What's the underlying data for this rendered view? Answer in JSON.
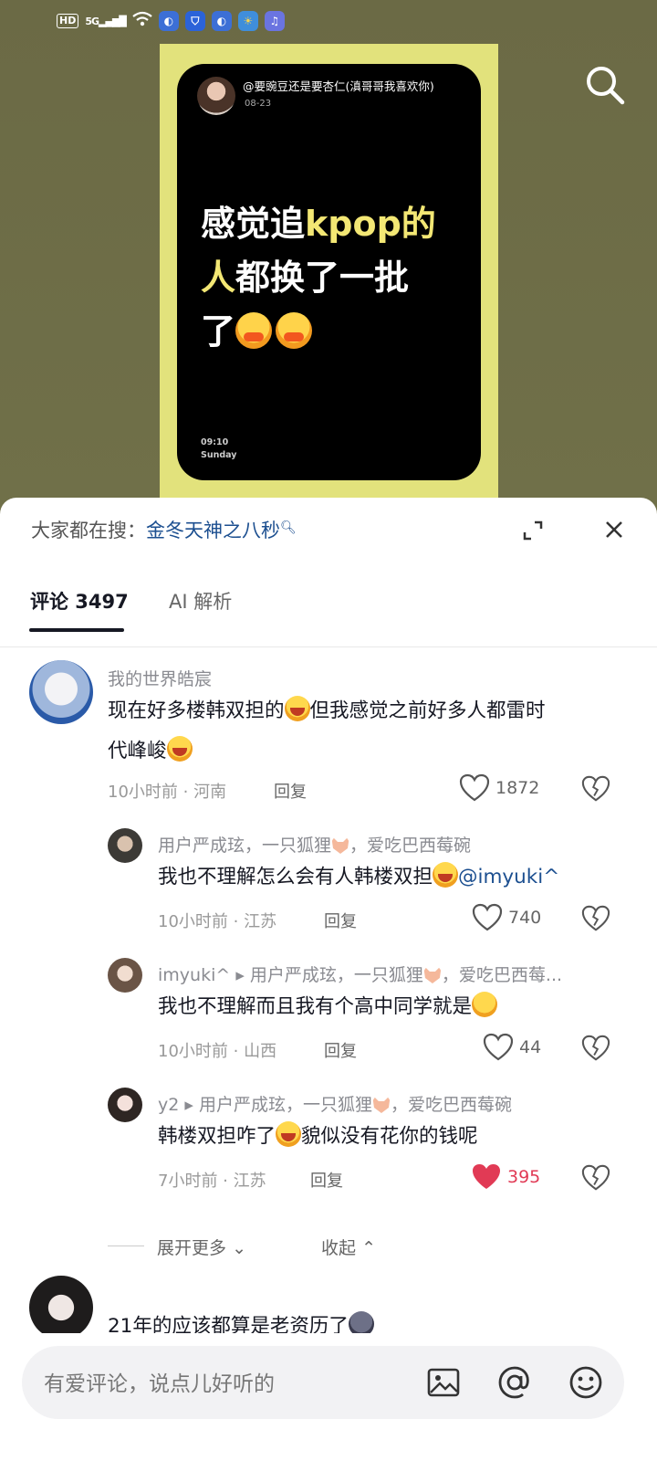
{
  "status_bar": {
    "hd": "HD",
    "network": "5G"
  },
  "video": {
    "poster_user": "@要豌豆还是要杏仁(滇哥哥我喜欢你)",
    "poster_date": "08-23",
    "poster_line1_a": "感觉追",
    "poster_line1_b": "kpop的",
    "poster_line2_a": "人",
    "poster_line2_b": "都换了一批",
    "poster_line3": "了",
    "poster_time": "09:10",
    "poster_day": "Sunday"
  },
  "sheet": {
    "hot_label": "大家都在搜：",
    "hot_keyword": "金冬天神之八秒",
    "tabs": [
      {
        "label": "评论 3497"
      },
      {
        "label": "AI 解析"
      }
    ]
  },
  "comments": [
    {
      "name": "我的世界皓宸",
      "text_a": "现在好多楼韩双担的",
      "text_b": "但我感觉之前好多人都雷时",
      "text_c": "代峰峻",
      "meta": "10小时前 · 河南",
      "reply": "回复",
      "likes": "1872"
    },
    {
      "name_a": "用户严成玹，一只狐狸",
      "name_b": "，爱吃巴西莓碗",
      "text_a": "我也不理解怎么会有人韩楼双担",
      "mention": "@imyuki^",
      "meta": "10小时前 · 江苏",
      "reply": "回复",
      "likes": "740"
    },
    {
      "name_a": "imyuki^ ▸ 用户严成玹，一只狐狸",
      "name_b": "，爱吃巴西莓...",
      "text_a": "我也不理解而且我有个高中同学就是",
      "meta": "10小时前 · 山西",
      "reply": "回复",
      "likes": "44"
    },
    {
      "name_a": "y2 ▸ 用户严成玹，一只狐狸",
      "name_b": "，爱吃巴西莓碗",
      "text_a": "韩楼双担咋了",
      "text_b": "貌似没有花你的钱呢",
      "meta": "7小时前 · 江苏",
      "reply": "回复",
      "likes": "395",
      "liked": true
    },
    {
      "text_a": "21年的应该都算是老资历了"
    }
  ],
  "expand_more": "展开更多",
  "collapse": "收起",
  "input": {
    "placeholder": "有爱评论，说点儿好听的"
  },
  "colors": {
    "accent_link": "#1c4f90",
    "like_active": "#e13a55",
    "poster_yellow": "#f3e774"
  }
}
